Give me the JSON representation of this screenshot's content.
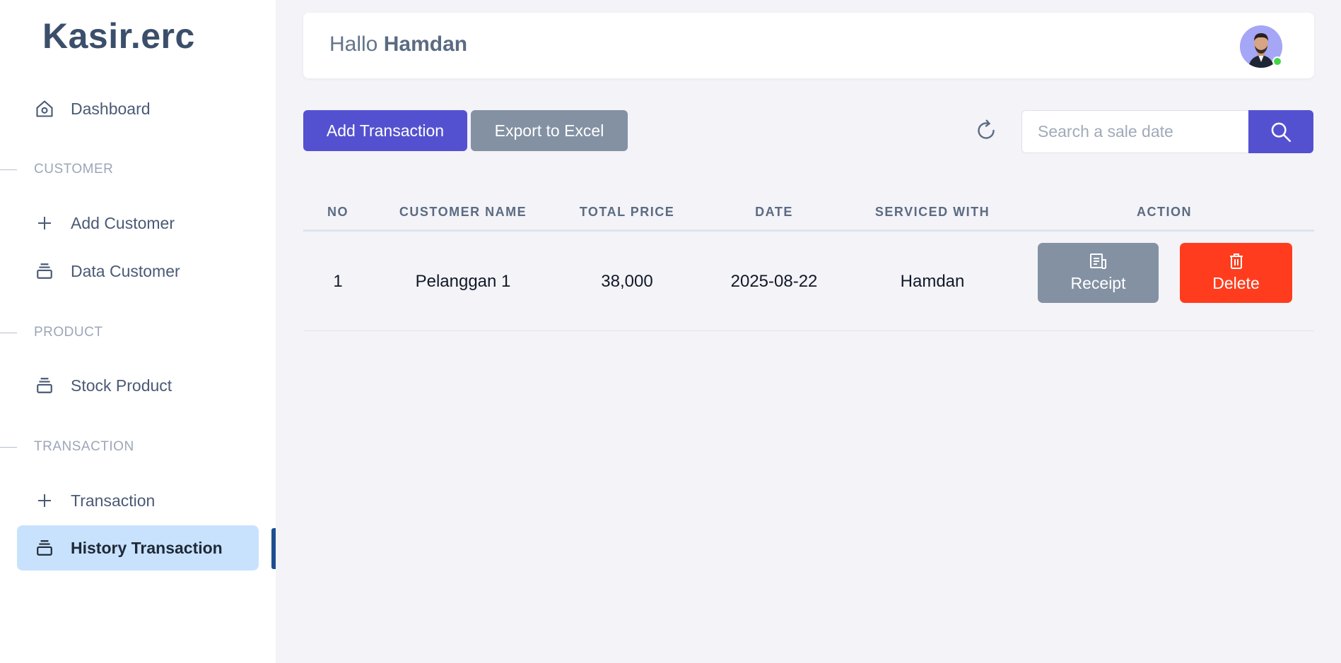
{
  "app": {
    "brand": "Kasir.erc"
  },
  "sidebar": {
    "dashboard": {
      "label": "Dashboard",
      "icon": "home-icon"
    },
    "sections": [
      {
        "label": "CUSTOMER",
        "items": [
          {
            "label": "Add Customer",
            "icon": "plus-icon"
          },
          {
            "label": "Data Customer",
            "icon": "stack-icon"
          }
        ]
      },
      {
        "label": "PRODUCT",
        "items": [
          {
            "label": "Stock Product",
            "icon": "stack-icon"
          }
        ]
      },
      {
        "label": "TRANSACTION",
        "items": [
          {
            "label": "Transaction",
            "icon": "plus-icon"
          },
          {
            "label": "History Transaction",
            "icon": "stack-icon",
            "active": true
          }
        ]
      }
    ]
  },
  "header": {
    "greeting": "Hallo",
    "user_name": "Hamdan",
    "status": "online"
  },
  "toolbar": {
    "add_label": "Add Transaction",
    "export_label": "Export to Excel",
    "search_placeholder": "Search a sale date",
    "accent": "#5451d0"
  },
  "table": {
    "columns": [
      "NO",
      "CUSTOMER NAME",
      "TOTAL PRICE",
      "DATE",
      "SERVICED WITH",
      "ACTION"
    ],
    "rows": [
      {
        "no": "1",
        "customer": "Pelanggan 1",
        "total": "38,000",
        "date": "2025-08-22",
        "serviced_by": "Hamdan"
      }
    ],
    "actions": {
      "receipt_label": "Receipt",
      "delete_label": "Delete"
    }
  },
  "colors": {
    "delete": "#ff3d1e",
    "secondary": "#8391a3",
    "active_nav": "#c8e2fd"
  }
}
